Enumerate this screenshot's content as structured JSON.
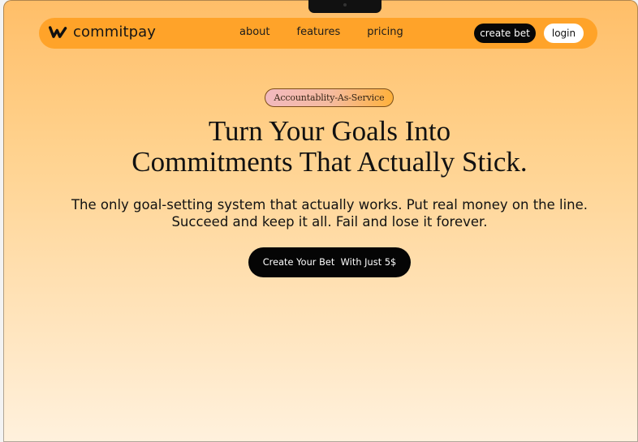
{
  "brand": {
    "name": "commitpay",
    "logo_icon": "w-zigzag-logo-icon"
  },
  "nav": {
    "links": [
      {
        "label": "about"
      },
      {
        "label": "features"
      },
      {
        "label": "pricing"
      }
    ],
    "create_bet_label": "create bet",
    "login_label": "login"
  },
  "hero": {
    "badge": "Accountablity-As-Service",
    "title_line_1": "Turn Your Goals Into",
    "title_line_2": "Commitments That Actually Stick.",
    "subtitle_line_1": "The only goal-setting system that actually works. Put real money on the line.",
    "subtitle_line_2": "Succeed and keep it all. Fail and lose it forever.",
    "cta_label": "Create Your Bet  With Just 5$"
  },
  "theme": {
    "accent": "#ffa329",
    "background_top": "#ffbe68",
    "background_bottom": "#fff1dd",
    "button_dark": "#070707"
  }
}
